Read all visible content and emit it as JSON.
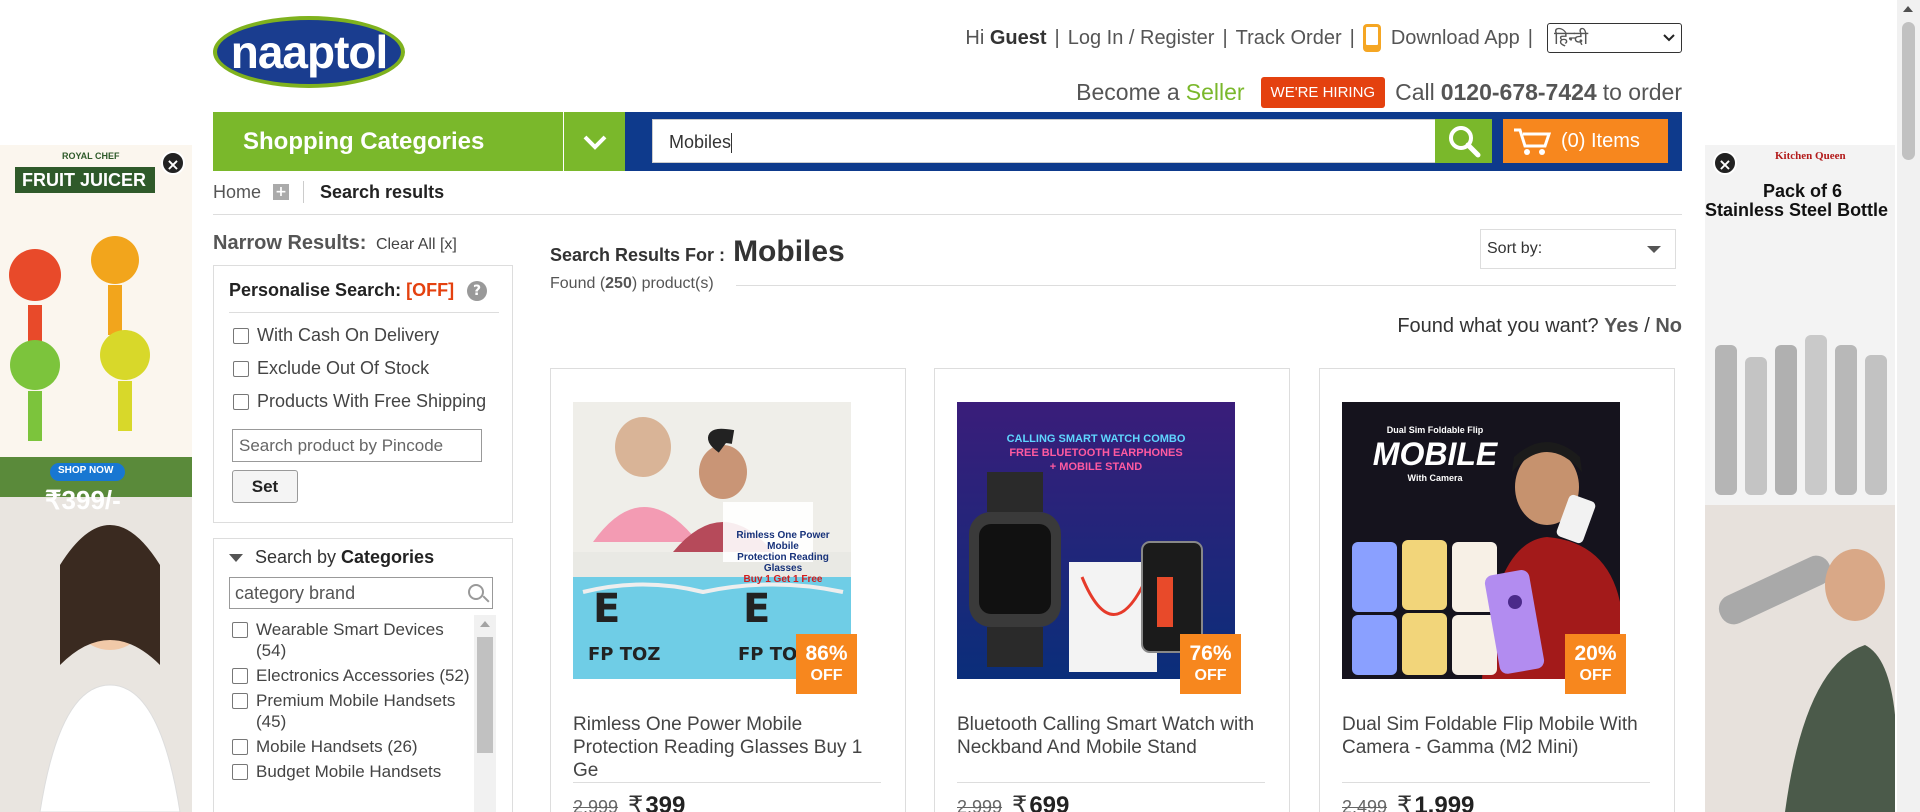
{
  "brand": {
    "logo_text": "naaptol"
  },
  "topbar": {
    "greeting": "Hi",
    "user": "Guest",
    "login": "Log In / Register",
    "track": "Track Order",
    "download": "Download App",
    "language": "हिन्दी"
  },
  "seller": {
    "become": "Become a",
    "seller": "Seller",
    "hiring": "WE'RE HIRING",
    "call": "Call",
    "phone": "0120-678-7424",
    "to_order": "to order"
  },
  "nav": {
    "categories_label": "Shopping Categories",
    "search_value": "Mobiles",
    "cart_label": "(0) Items"
  },
  "breadcrumb": {
    "home": "Home",
    "current": "Search results"
  },
  "filters": {
    "narrow": "Narrow Results:",
    "clear": "Clear All [x]",
    "personalise": "Personalise Search:",
    "personalise_state": "[OFF]",
    "options": [
      "With Cash On Delivery",
      "Exclude Out Of Stock",
      "Products With Free Shipping"
    ],
    "pincode_placeholder": "Search product by Pincode",
    "set_label": "Set",
    "search_by": "Search by",
    "categories_word": "Categories",
    "category_placeholder": "category brand",
    "categories": [
      {
        "name": "Wearable Smart Devices",
        "count": "(54)"
      },
      {
        "name": "Electronics Accessories",
        "count": "(52)"
      },
      {
        "name": "Premium Mobile Handsets",
        "count": "(45)"
      },
      {
        "name": "Mobile Handsets",
        "count": "(26)"
      },
      {
        "name": "Budget Mobile Handsets",
        "count": ""
      }
    ]
  },
  "results": {
    "for_label": "Search Results For :",
    "keyword": "Mobiles",
    "found_prefix": "Found (",
    "found_count": "250",
    "found_suffix": ") product(s)",
    "sort_label": "Sort by:",
    "found_want": "Found what you want?",
    "yes": "Yes",
    "slash": "/",
    "no": "No"
  },
  "products": [
    {
      "title": "Rimless One Power Mobile Protection Reading Glasses Buy 1 Ge",
      "discount": "86%",
      "off": "OFF",
      "mrp": "2,999",
      "currency": "₹",
      "price": "399"
    },
    {
      "title": "Bluetooth Calling Smart Watch with Neckband And Mobile Stand",
      "discount": "76%",
      "off": "OFF",
      "mrp": "2,999",
      "currency": "₹",
      "price": "699"
    },
    {
      "title": "Dual Sim Foldable Flip Mobile With Camera - Gamma (M2 Mini)",
      "discount": "20%",
      "off": "OFF",
      "mrp": "2,499",
      "currency": "₹",
      "price": "1,999"
    }
  ],
  "product_image_text": {
    "p1_line1": "Rimless One Power Mobile",
    "p1_line2": "Protection Reading Glasses",
    "p1_line3": "Buy 1 Get 1 Free",
    "p2_line1": "CALLING SMART WATCH COMBO",
    "p2_line2": "FREE BLUETOOTH EARPHONES",
    "p2_line3": "+ MOBILE STAND",
    "p3_line1": "Dual Sim Foldable Flip",
    "p3_line2": "MOBILE",
    "p3_line3": "With Camera"
  },
  "ads": {
    "left_brand": "ROYAL CHEF",
    "left_title": "FRUIT JUICER",
    "left_cta": "SHOP NOW",
    "left_price": "₹399/-",
    "right_brand": "Kitchen Queen",
    "right_line1": "Pack of 6",
    "right_line2": "Stainless Steel Bottle"
  },
  "colors": {
    "green": "#7ab82b",
    "navy": "#0e3a8c",
    "orange": "#f7871e",
    "red": "#e4410f"
  }
}
